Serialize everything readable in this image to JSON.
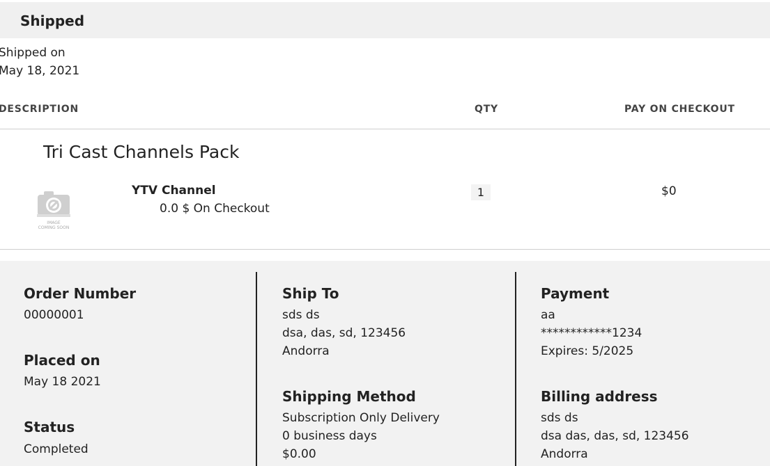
{
  "status": {
    "title": "Shipped",
    "shipped_label": "Shipped on",
    "shipped_date": "May 18, 2021"
  },
  "table": {
    "headers": {
      "description": "DESCRIPTION",
      "qty": "QTY",
      "pay": "PAY ON CHECKOUT"
    },
    "pack_title": "Tri Cast Channels Pack",
    "item": {
      "name": "YTV Channel",
      "price_note": "0.0 $ On Checkout",
      "qty": "1",
      "pay_amount": "$0",
      "image_icon": "image-coming-soon-icon",
      "image_caption_1": "IMAGE",
      "image_caption_2": "COMING SOON"
    }
  },
  "summary": {
    "order_number": {
      "label": "Order Number",
      "value": "00000001"
    },
    "placed_on": {
      "label": "Placed on",
      "value": "May 18 2021"
    },
    "status": {
      "label": "Status",
      "value": "Completed"
    },
    "ship_to": {
      "label": "Ship To",
      "lines": [
        "sds ds",
        "dsa, das, sd, 123456",
        "Andorra"
      ]
    },
    "shipping_method": {
      "label": "Shipping Method",
      "lines": [
        "Subscription Only Delivery",
        "0 business days",
        "$0.00"
      ]
    },
    "payment": {
      "label": "Payment",
      "lines": [
        "aa",
        "************1234",
        "Expires: 5/2025"
      ]
    },
    "billing_address": {
      "label": "Billing address",
      "lines": [
        "sds ds",
        "dsa das, das, sd, 123456",
        "Andorra"
      ]
    }
  },
  "colors": {
    "header_bg": "#f0f0f0",
    "summary_bg": "#f2f2f2",
    "text": "#222222",
    "rule": "#cfcfcf"
  }
}
